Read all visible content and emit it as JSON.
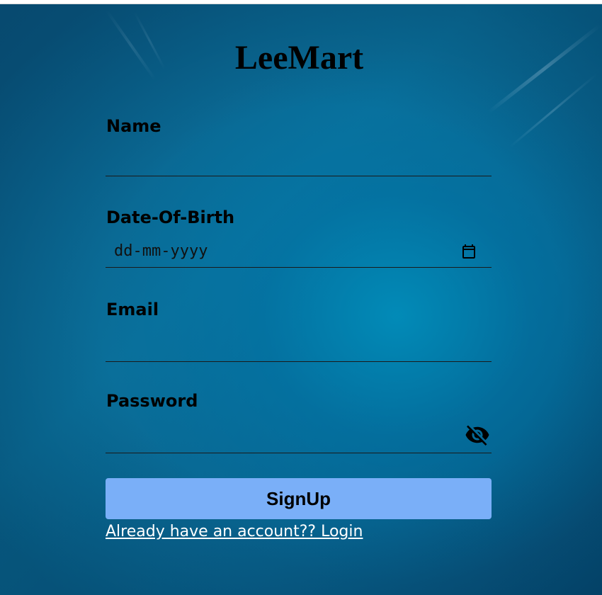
{
  "app": {
    "title": "LeeMart"
  },
  "form": {
    "name": {
      "label": "Name",
      "value": ""
    },
    "dob": {
      "label": "Date-Of-Birth",
      "placeholder": "dd-mm-yyyy",
      "icon": "calendar-icon"
    },
    "email": {
      "label": "Email",
      "value": ""
    },
    "password": {
      "label": "Password",
      "value": "",
      "icon": "eye-off-icon"
    },
    "submit_label": "SignUp",
    "login_link": "Already have an account?? Login"
  },
  "colors": {
    "button": "#7aaff8",
    "background": "#0a6f9a",
    "text": "#000000",
    "link": "#ffffff"
  }
}
